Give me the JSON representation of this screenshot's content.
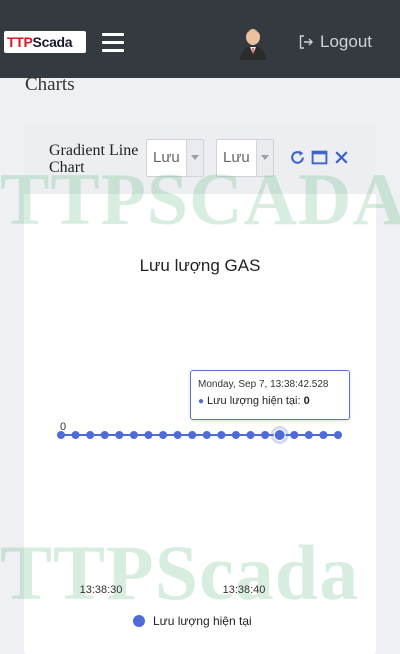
{
  "header": {
    "logo_prefix": "TTP",
    "logo_suffix": "Scada",
    "logout_label": "Logout"
  },
  "page": {
    "title": "Charts"
  },
  "card": {
    "title": "Gradient Line Chart",
    "select1_value": "Lưu",
    "select2_value": "Lưu"
  },
  "watermark": {
    "top": "TTPSCADA",
    "bottom": "TTPScada"
  },
  "chart_data": {
    "type": "line",
    "title": "Lưu lượng GAS",
    "xlabel": "",
    "ylabel": "",
    "x_tick_labels": [
      "13:38:30",
      "13:38:40"
    ],
    "y_tick_labels": [
      "0"
    ],
    "series": [
      {
        "name": "Lưu lượng hiện tại",
        "color": "#4f6bd8",
        "values": [
          0,
          0,
          0,
          0,
          0,
          0,
          0,
          0,
          0,
          0,
          0,
          0,
          0,
          0,
          0,
          0,
          0,
          0,
          0,
          0
        ]
      }
    ],
    "highlight_index": 15,
    "tooltip": {
      "date": "Monday, Sep 7, 13:38:42.528",
      "label": "Lưu lượng hiện tại:",
      "value": "0"
    },
    "legend_position": "bottom",
    "grid": false
  },
  "colors": {
    "topbar": "#343a40",
    "series": "#4f6bd8"
  }
}
